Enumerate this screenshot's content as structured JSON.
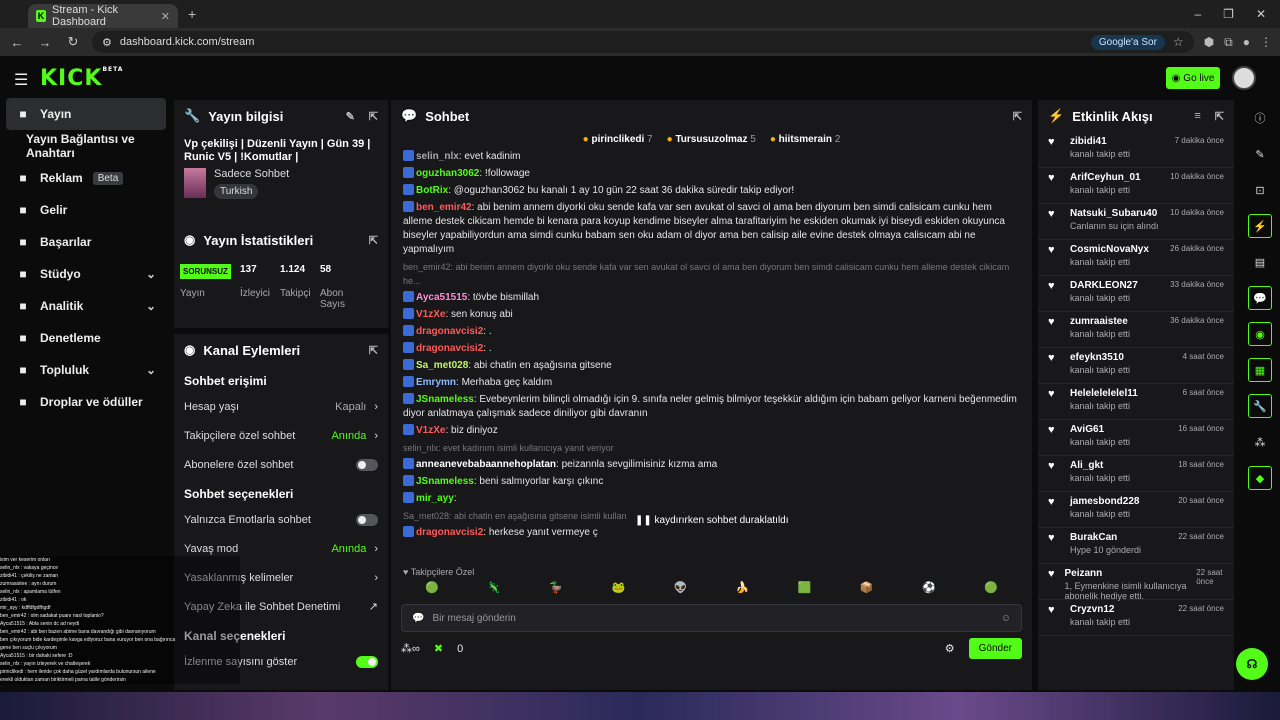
{
  "browser": {
    "tab_title": "Stream - Kick Dashboard",
    "url": "dashboard.kick.com/stream",
    "google_btn": "Google'a Sor"
  },
  "topnav": {
    "logo": "KICK",
    "logo_sup": "BETA",
    "go_live": "Go live"
  },
  "sidebar": [
    {
      "label": "Yayın",
      "icon": "broadcast-icon",
      "active": true
    },
    {
      "label": "Yayın Bağlantısı ve Anahtarı",
      "sub": true
    },
    {
      "label": "Reklam",
      "badge": "Beta",
      "icon": "ad-icon"
    },
    {
      "label": "Gelir",
      "icon": "revenue-icon"
    },
    {
      "label": "Başarılar",
      "icon": "trophy-icon"
    },
    {
      "label": "Stüdyo",
      "icon": "studio-icon",
      "chev": true
    },
    {
      "label": "Analitik",
      "icon": "analytics-icon",
      "chev": true
    },
    {
      "label": "Denetleme",
      "icon": "wrench-icon"
    },
    {
      "label": "Topluluk",
      "icon": "community-icon",
      "chev": true
    },
    {
      "label": "Droplar ve ödüller",
      "icon": "drops-icon"
    }
  ],
  "stream_info": {
    "title": "Yayın bilgisi",
    "stream_title": "Vp çekilişi | Düzenli Yayın | Gün 39 | Runic V5 | !Komutlar |",
    "category": "Sadece Sohbet",
    "tag": "Turkish"
  },
  "stats": {
    "title": "Yayın İstatistikleri",
    "items": [
      {
        "v": "SORUNSUZ",
        "l": "Yayın"
      },
      {
        "v": "137",
        "l": "İzleyici"
      },
      {
        "v": "1.124",
        "l": "Takipçi"
      },
      {
        "v": "58",
        "l": "Abon Sayıs"
      }
    ]
  },
  "channel": {
    "title": "Kanal Eylemleri",
    "sec1": "Sohbet erişimi",
    "rows1": [
      {
        "label": "Hesap yaşı",
        "value": "Kapalı",
        "type": "chev"
      },
      {
        "label": "Takipçilere özel sohbet",
        "value": "Anında",
        "type": "chev",
        "green": true
      },
      {
        "label": "Abonelere özel sohbet",
        "type": "toggle"
      }
    ],
    "sec2": "Sohbet seçenekleri",
    "rows2": [
      {
        "label": "Yalnızca Emotlarla sohbet",
        "type": "toggle"
      },
      {
        "label": "Yavaş mod",
        "value": "Anında",
        "type": "chev",
        "green": true
      },
      {
        "label": "Yasaklanmış kelimeler",
        "type": "chev"
      },
      {
        "label": "Yapay Zeka ile Sohbet Denetimi",
        "type": "ext"
      }
    ],
    "sec3": "Kanal seçenekleri",
    "row3": "İzlenme sayısını göster"
  },
  "chat": {
    "title": "Sohbet",
    "leaders": [
      {
        "name": "pirinclikedi",
        "n": "7"
      },
      {
        "name": "Tursusuzolmaz",
        "n": "5"
      },
      {
        "name": "hiitsmerain",
        "n": "2"
      }
    ],
    "messages": [
      {
        "user": "selin_nlx",
        "text": "evet kadinim",
        "color": "#aaa"
      },
      {
        "user": "oguzhan3062",
        "text": "!followage",
        "color": "#53fc18"
      },
      {
        "user": "BotRix",
        "text": "@oguzhan3062 bu kanalı 1 ay 10 gün 22 saat 36 dakika süredir takip ediyor!",
        "color": "#53fc18"
      },
      {
        "user": "ben_emir42",
        "text": "abi benim annem diyorki oku sende kafa var sen avukat ol savci ol ama ben diyorum ben simdi calisicam cunku hem alleme destek cikicam hemde bi kenara para koyup kendime biseyler alma tarafitariyim he eskiden okumak iyi biseydi eskiden okuyunca biseyler yapabiliyordun ama simdi cunku babam sen oku adam ol diyor ama ben calisip aile evine destek olmaya calisıcam abi ne yapmalıyım",
        "color": "#ff5a5a"
      },
      {
        "dim": true,
        "text": "ben_emir42: abi benim annem diyorki oku sende kafa var sen avukat ol savci ol ama ben diyorum ben simdi calisicam cunku hem alleme destek cikicam he..."
      },
      {
        "user": "Ayca51515",
        "text": "tövbe bismillah",
        "color": "#ff8ad8"
      },
      {
        "user": "V1zXe",
        "text": "sen konuş abi",
        "color": "#ff5a5a"
      },
      {
        "user": "dragonavcisi2",
        "text": ".",
        "color": "#ff5a5a"
      },
      {
        "user": "dragonavcisi2",
        "text": ".",
        "color": "#ff5a5a"
      },
      {
        "user": "Sa_met028",
        "text": "abi chatin en aşağısına gitsene",
        "color": "#c2f56a"
      },
      {
        "user": "Emrymn",
        "text": "Merhaba geç kaldım",
        "color": "#8fb8ff"
      },
      {
        "user": "JSnameless",
        "text": "Evebeynlerim bilinçli olmadığı için 9. sınıfa neler gelmiş bilmiyor teşekkür aldığım için babam geliyor karneni beğenmedim diyor anlatmaya çalışmak sadece diniliyor gibi davranın",
        "color": "#53fc18"
      },
      {
        "user": "V1zXe",
        "text": "biz diniyoz",
        "color": "#ff5a5a"
      },
      {
        "dim": true,
        "text": "selin_nlx: evet kadınım isimli kullanıcıya yanıt veriyor"
      },
      {
        "user": "anneanevebabaannehoplatan",
        "text": "peizannla sevgilimisiniz kızma ama",
        "color": "#fff"
      },
      {
        "user": "JSnameless",
        "text": "beni salmıyorlar karşı çıkınc",
        "color": "#53fc18"
      },
      {
        "user": "mir_ayy",
        "text": "",
        "color": "#53fc18"
      },
      {
        "dim": true,
        "text": "Sa_met028: abi chatin en aşağısına gitsene isimli kullanıcıya yanıt veriyor"
      },
      {
        "user": "dragonavcisi2",
        "text": "herkese yanıt vermeye ç",
        "color": "#ff5a5a"
      }
    ],
    "paused": "kaydırırken sohbet duraklatıldı",
    "followers_only": "Takipçilere Özel",
    "placeholder": "Bir mesaj gönderin",
    "count": "0",
    "send": "Gönder"
  },
  "activity": {
    "title": "Etkinlik Akışı",
    "items": [
      {
        "name": "zibidi41",
        "desc": "kanalı takip etti",
        "time": "7 dakika önce"
      },
      {
        "name": "ArifCeyhun_01",
        "desc": "kanalı takip etti",
        "time": "10 dakika önce"
      },
      {
        "name": "Natsuki_Subaru40",
        "desc": "Canlanın su için alındı",
        "time": "10 dakika önce",
        "green": true
      },
      {
        "name": "CosmicNovaNyx",
        "desc": "kanalı takip etti",
        "time": "26 dakika önce"
      },
      {
        "name": "DARKLEON27",
        "desc": "kanalı takip etti",
        "time": "33 dakika önce"
      },
      {
        "name": "zumraaistee",
        "desc": "kanalı takip etti",
        "time": "36 dakika önce"
      },
      {
        "name": "efeykn3510",
        "desc": "kanalı takip etti",
        "time": "4 saat önce"
      },
      {
        "name": "Helelelelelel11",
        "desc": "kanalı takip etti",
        "time": "6 saat önce"
      },
      {
        "name": "AviG61",
        "desc": "kanalı takip etti",
        "time": "16 saat önce"
      },
      {
        "name": "Ali_gkt",
        "desc": "kanalı takip etti",
        "time": "18 saat önce"
      },
      {
        "name": "jamesbond228",
        "desc": "kanalı takip etti",
        "time": "20 saat önce"
      },
      {
        "name": "BurakCan",
        "desc": "Hype 10 gönderdi",
        "time": "22 saat önce",
        "green": true
      },
      {
        "name": "Peizann",
        "desc": "1, Eymenkine isimli kullanıcıya abonelik hediye etti.",
        "time": "22 saat önce",
        "green": true
      },
      {
        "name": "Cryzvn12",
        "desc": "kanalı takip etti",
        "time": "22 saat önce"
      }
    ]
  },
  "overlay": [
    "isim ver keserim onları",
    "selin_nlx : vakaya geçince",
    "zibidi41 : çekiliş ne zaman",
    "zumraaistee : aynı durum",
    "selin_nlx : apamlama lütfen",
    "zibidi41 : ok",
    "mir_ayy : kdffdfgdfhgdf",
    "ben_emir42 : olm sadakat puanı nasl toplanio?",
    "Ayca51515 : Abla senin dc ad neydi",
    "ben_emir42 : abi ben bazen abime bana davrandığı gibi davranıyorum",
    "ben çıkıyorum bide kardeşimle kavga ediyoruz bana vuruyor ben ona bağırınca",
    "gene ben suçlu çıkıyorum",
    "Ayca51515 : bir dahaki sefere :D",
    "selin_nlx : yayın izleyerek ve chatleşerek",
    "pirinclikedi : hem ileride çok daha güzel yardımlarda bulunursun ailene",
    "enekli olduktan zaman biriktirmeli parna tatile gönderirsin"
  ]
}
